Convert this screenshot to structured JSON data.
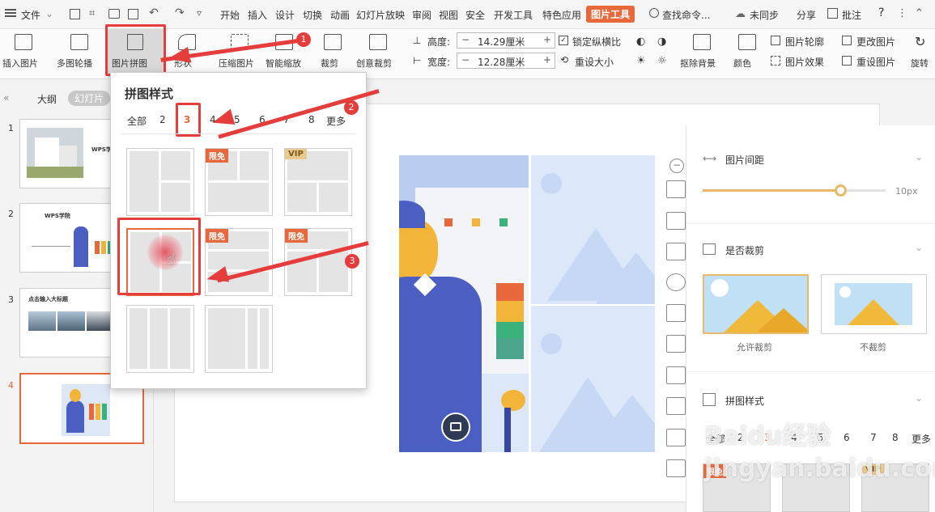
{
  "menubar": {
    "file": "文件",
    "tabs": [
      "开始",
      "插入",
      "设计",
      "切换",
      "动画",
      "幻灯片放映",
      "审阅",
      "视图",
      "安全",
      "开发工具",
      "特色应用"
    ],
    "active_tab": "图片工具",
    "search": "查找命令...",
    "unsync": "未同步",
    "share": "分享",
    "annotate": "批注",
    "help": "?"
  },
  "ribbon": {
    "insert_picture": "插入图片",
    "multi_carousel": "多图轮播",
    "collage": "图片拼图",
    "shape": "形状",
    "compress": "压缩图片",
    "smart_zoom": "智能缩放",
    "crop": "裁剪",
    "creative_crop": "创意裁剪",
    "height_label": "高度:",
    "height_value": "14.29厘米",
    "width_label": "宽度:",
    "width_value": "12.28厘米",
    "lock_ratio": "锁定纵横比",
    "reset_size": "重设大小",
    "remove_bg": "抠除背景",
    "color": "颜色",
    "outline": "图片轮廓",
    "effects": "图片效果",
    "change_pic": "更改图片",
    "reset_pic": "重设图片",
    "rotate": "旋转"
  },
  "leftpanel": {
    "tab_outline": "大纲",
    "tab_slides": "幻灯片",
    "thumbs": [
      {
        "num": "1",
        "title": "WPS学院"
      },
      {
        "num": "2",
        "title": "WPS学院"
      },
      {
        "num": "3",
        "title": "点击输入大标题"
      },
      {
        "num": "4",
        "title": ""
      }
    ]
  },
  "dropdown": {
    "title": "拼图样式",
    "filters": [
      "全部",
      "2",
      "3",
      "4",
      "5",
      "6",
      "7",
      "8",
      "更多"
    ],
    "selected_filter": "3",
    "badges": {
      "free": "限免",
      "vip": "VIP"
    }
  },
  "right_panel": {
    "spacing_title": "图片间距",
    "spacing_value": "10px",
    "spacing_fraction": 0.75,
    "crop_title": "是否裁剪",
    "allow_crop": "允许裁剪",
    "no_crop": "不裁剪",
    "style_title": "拼图样式",
    "filters": [
      "全部",
      "2",
      "3",
      "4",
      "5",
      "6",
      "7",
      "8",
      "更多"
    ],
    "badges": {
      "free": "限免",
      "vip": "VIP"
    }
  },
  "annotations": {
    "n1": "1",
    "n2": "2",
    "n3": "3"
  },
  "watermark": "Baidu经验 jingyan.baidu.com",
  "colors": {
    "accent": "#e8683c",
    "arrow": "#e53c3c",
    "figure_blue": "#4a5fc1"
  }
}
